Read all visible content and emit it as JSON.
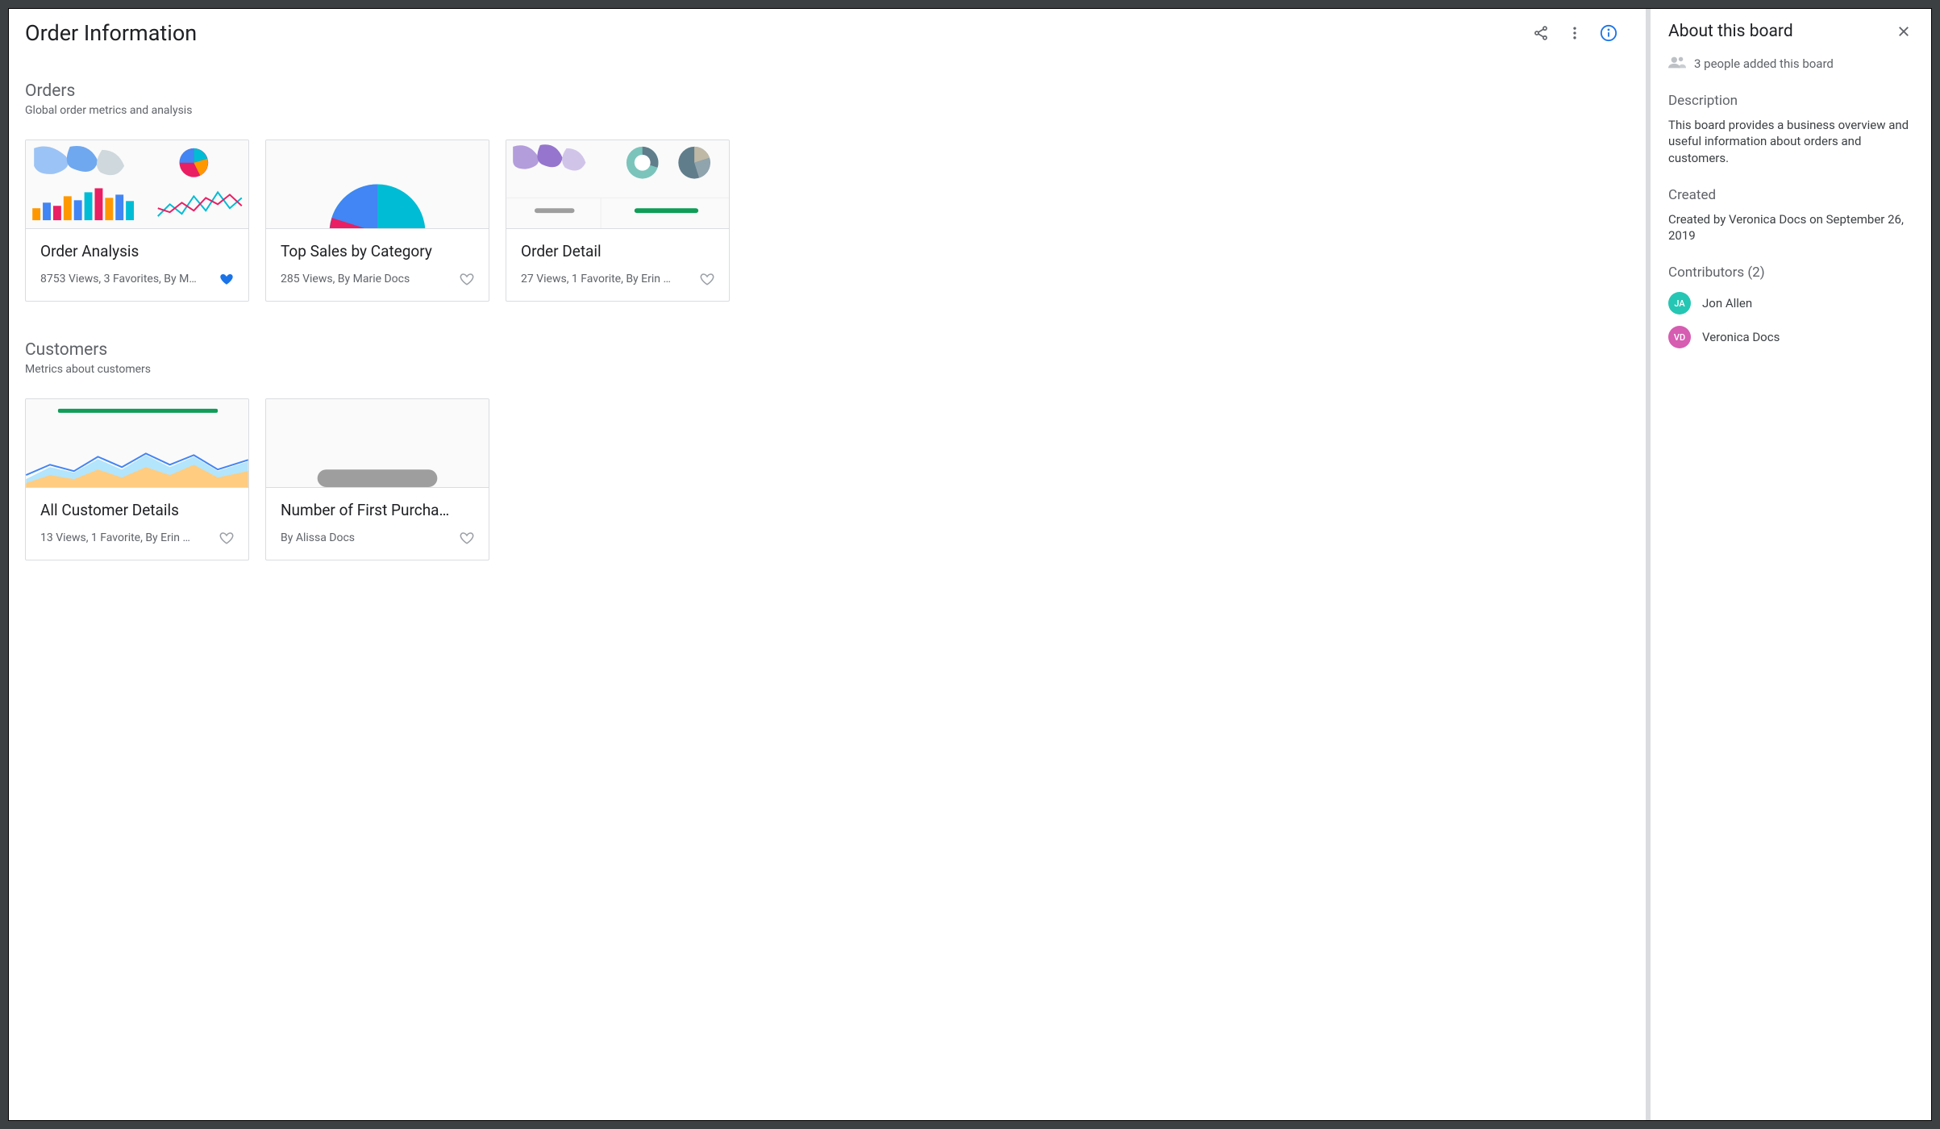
{
  "page": {
    "title": "Order Information"
  },
  "sections": [
    {
      "title": "Orders",
      "subtitle": "Global order metrics and analysis",
      "cards": [
        {
          "title": "Order Analysis",
          "meta": "8753 Views, 3 Favorites, By M…",
          "favorited": true
        },
        {
          "title": "Top Sales by Category",
          "meta": "285 Views, By Marie Docs",
          "favorited": false
        },
        {
          "title": "Order Detail",
          "meta": "27 Views, 1 Favorite, By Erin …",
          "favorited": false
        }
      ]
    },
    {
      "title": "Customers",
      "subtitle": "Metrics about customers",
      "cards": [
        {
          "title": "All Customer Details",
          "meta": "13 Views, 1 Favorite, By Erin …",
          "favorited": false
        },
        {
          "title": "Number of First Purcha…",
          "meta": "By Alissa Docs",
          "favorited": false
        }
      ]
    }
  ],
  "about": {
    "heading": "About this board",
    "people_added": "3 people added this board",
    "description_label": "Description",
    "description": "This board provides a business overview and useful information about orders and customers.",
    "created_label": "Created",
    "created": "Created by Veronica Docs on September 26, 2019",
    "contributors_label": "Contributors (2)",
    "contributors": [
      {
        "initials": "JA",
        "name": "Jon Allen",
        "color": "teal"
      },
      {
        "initials": "VD",
        "name": "Veronica Docs",
        "color": "pink"
      }
    ]
  }
}
